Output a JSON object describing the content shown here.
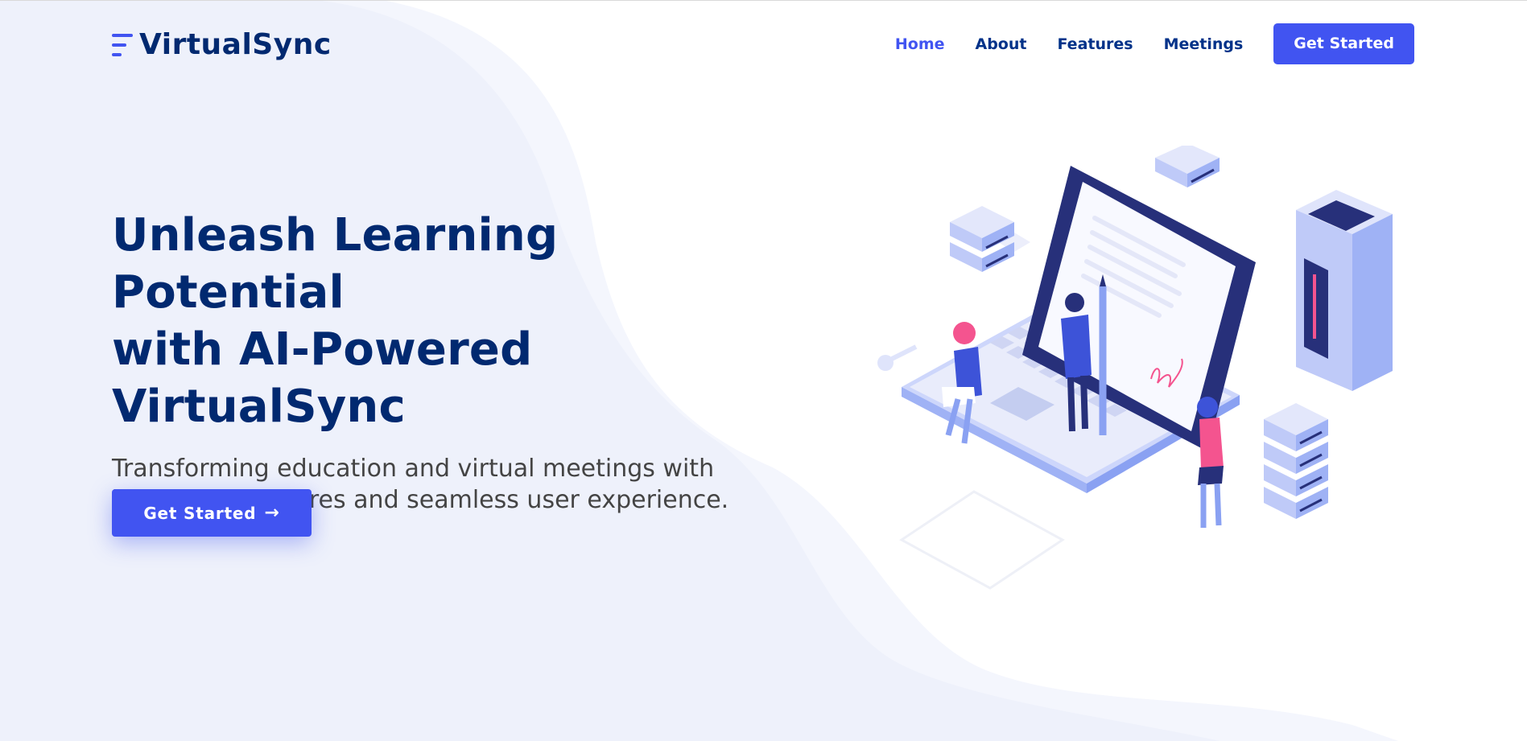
{
  "brand": {
    "name": "VirtualSync",
    "accent_color": "#4154f1",
    "heading_color": "#012970"
  },
  "nav": {
    "items": [
      {
        "label": "Home",
        "active": true
      },
      {
        "label": "About",
        "active": false
      },
      {
        "label": "Features",
        "active": false
      },
      {
        "label": "Meetings",
        "active": false
      }
    ],
    "cta_label": "Get Started"
  },
  "hero": {
    "title_lines": [
      "Unleash Learning Potential",
      "with AI-Powered",
      "VirtualSync"
    ],
    "subtitle_lines": [
      "Transforming education and virtual meetings with",
      "innovative features and seamless user experience."
    ],
    "cta_label": "Get Started",
    "cta_icon": "arrow-right-icon"
  },
  "illustration": {
    "subject": "isometric-laptop-illustration"
  }
}
